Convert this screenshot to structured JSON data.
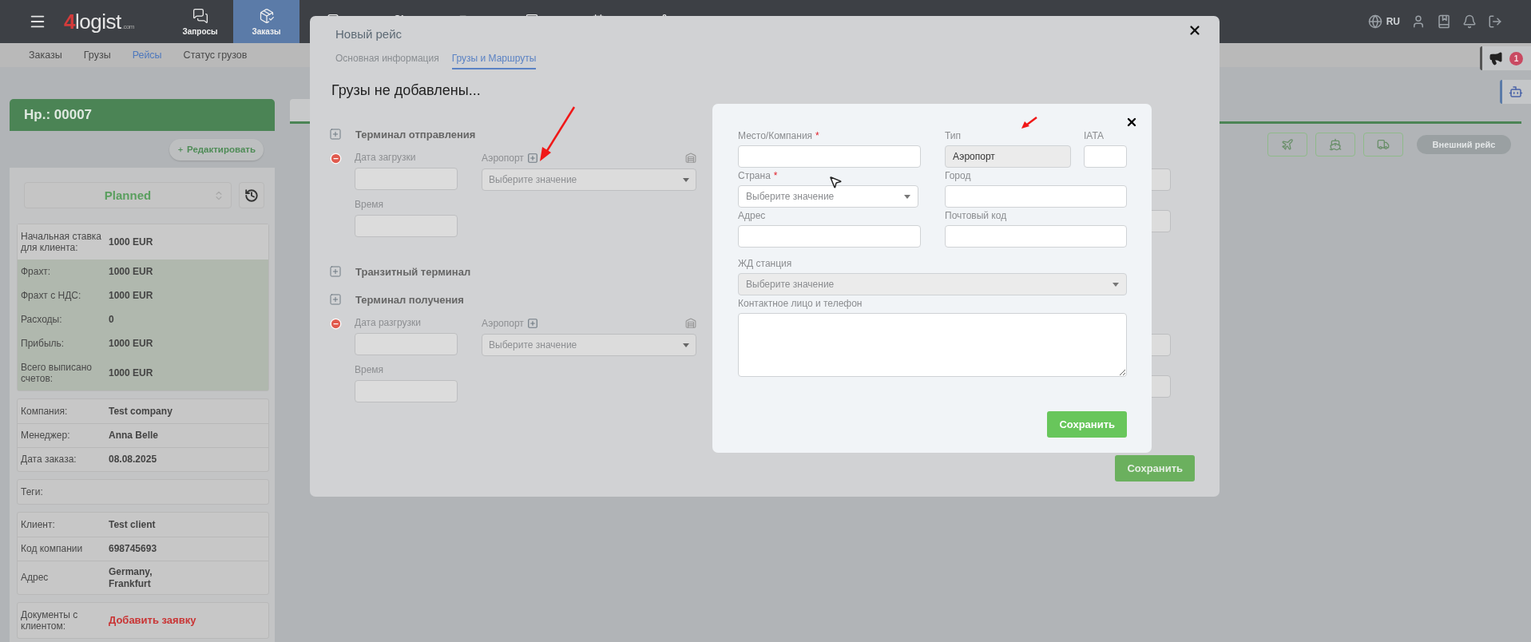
{
  "header": {
    "logo": {
      "mark": "4",
      "name": "logist",
      "suffix": ".com"
    },
    "nav": [
      {
        "label": "Запросы",
        "selected": false
      },
      {
        "label": "Заказы",
        "selected": true
      },
      {
        "selected": false
      },
      {
        "selected": false
      },
      {
        "selected": false
      },
      {
        "selected": false
      },
      {
        "selected": false
      },
      {
        "selected": false
      }
    ],
    "language": "RU"
  },
  "subnav": [
    {
      "label": "Заказы",
      "selected": false
    },
    {
      "label": "Грузы",
      "selected": false
    },
    {
      "label": "Рейсы",
      "selected": true
    },
    {
      "label": "Статус грузов",
      "selected": false
    }
  ],
  "side_tabs": {
    "badge": "1"
  },
  "order": {
    "number": "Нр.: 00007",
    "edit_button": "Редактировать",
    "status": "Planned",
    "finance": [
      {
        "label": "Начальная ставка для клиента:",
        "value": "1000 EUR",
        "highlighted": false
      },
      {
        "label": "Фрахт:",
        "value": "1000 EUR",
        "highlighted": true
      },
      {
        "label": "Фрахт с НДС:",
        "value": "1000 EUR",
        "highlighted": true
      },
      {
        "label": "Расходы:",
        "value": "0",
        "highlighted": true
      },
      {
        "label": "Прибыль:",
        "value": "1000 EUR",
        "highlighted": true
      },
      {
        "label": "Всего выписано счетов:",
        "value": "1000 EUR",
        "highlighted": true
      }
    ],
    "details": [
      {
        "label": "Компания:",
        "value": "Test company"
      },
      {
        "label": "Менеджер:",
        "value": "Anna Belle"
      },
      {
        "label": "Дата заказа:",
        "value": "08.08.2025"
      }
    ],
    "tags_label": "Теги:",
    "client": [
      {
        "label": "Клиент:",
        "value": "Test client"
      },
      {
        "label": "Код компании",
        "value": "698745693"
      },
      {
        "label": "Адрес",
        "value": "Germany,\nFrankfurt"
      }
    ],
    "documents": {
      "label": "Документы с клиентом:",
      "link": "Добавить заявку"
    }
  },
  "external_trip_button": "Внешний рейс",
  "modal": {
    "title": "Новый рейс",
    "tabs": [
      {
        "label": "Основная информация",
        "selected": false
      },
      {
        "label": "Грузы и Маршруты",
        "selected": true
      }
    ],
    "empty_message": "Грузы не добавлены...",
    "sections": [
      {
        "title": "Терминал отправления",
        "date_label": "Дата загрузки",
        "time_label": "Время",
        "airport_label": "Аэропорт",
        "airport_placeholder": "Выберите значение"
      },
      {
        "title": "Транзитный терминал"
      },
      {
        "title": "Терминал получения",
        "date_label": "Дата разгрузки",
        "time_label": "Время",
        "airport_label": "Аэропорт",
        "airport_placeholder": "Выберите значение"
      }
    ],
    "save_button": "Сохранить"
  },
  "location_dialog": {
    "fields": [
      {
        "label": "Место/Компания",
        "required_mark": "*",
        "kind": "input"
      },
      {
        "label": "Тип",
        "kind": "readonly",
        "value": "Аэропорт"
      },
      {
        "label": "IATA",
        "kind": "input"
      },
      {
        "label": "Страна",
        "required_mark": "*",
        "kind": "select",
        "placeholder": "Выберите значение",
        "disabled": false
      },
      {
        "label": "Город",
        "kind": "input"
      },
      {
        "label": "Адрес",
        "kind": "input"
      },
      {
        "label": "Почтовый код",
        "kind": "input"
      },
      {
        "label": "ЖД станция",
        "kind": "select",
        "placeholder": "Выберите значение",
        "disabled": true
      },
      {
        "label": "Контактное лицо и телефон",
        "kind": "textarea"
      }
    ],
    "save_button": "Сохранить"
  }
}
